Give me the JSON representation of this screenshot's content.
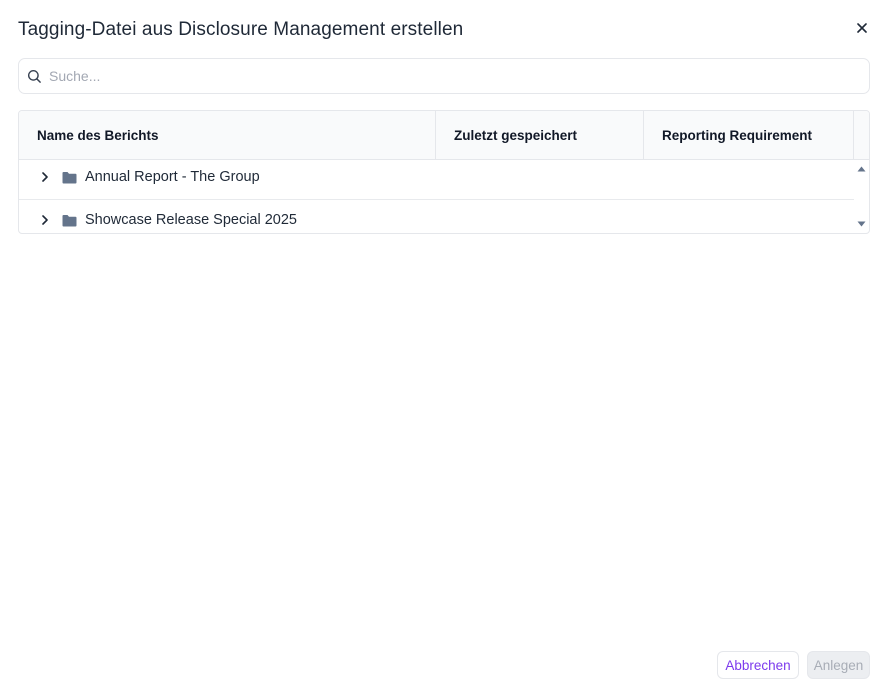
{
  "dialog": {
    "title": "Tagging-Datei aus Disclosure Management erstellen",
    "close_icon": "close-icon"
  },
  "search": {
    "placeholder": "Suche...",
    "value": "",
    "icon": "search-icon"
  },
  "table": {
    "columns": [
      "Name des Berichts",
      "Zuletzt gespeichert",
      "Reporting Requirement"
    ],
    "rows": [
      {
        "name": "Annual Report - The Group",
        "last_saved": "",
        "reporting_requirement": "",
        "icon": "folder-icon",
        "expanded": false
      },
      {
        "name": "Showcase Release Special 2025",
        "last_saved": "",
        "reporting_requirement": "",
        "icon": "folder-icon",
        "expanded": false
      }
    ]
  },
  "footer": {
    "cancel_label": "Abbrechen",
    "create_label": "Anlegen"
  },
  "colors": {
    "accent": "#7c3aed",
    "text": "#1f2937",
    "border": "#e5e7eb",
    "header_bg": "#f9fafb",
    "folder": "#64748b",
    "disabled_bg": "#eceef1",
    "disabled_text": "#a8adb6"
  }
}
